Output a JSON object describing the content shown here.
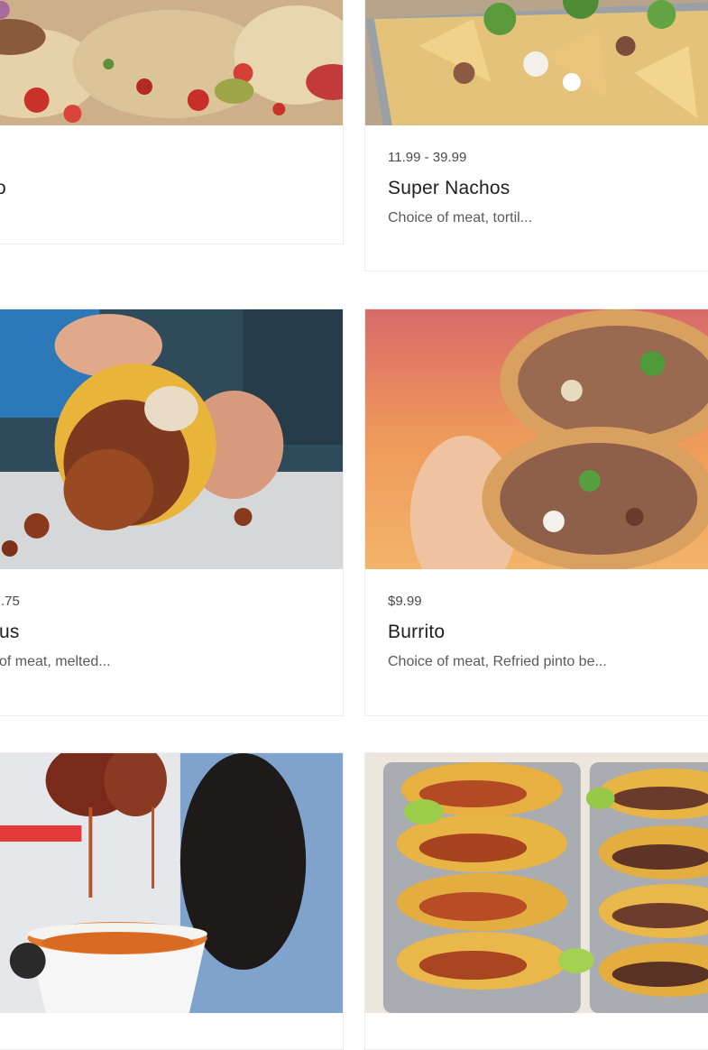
{
  "menu": {
    "items": [
      {
        "price": "",
        "name": "piro",
        "description": "",
        "photo_icon": "tacos-platter-photo"
      },
      {
        "price": "11.99 - 39.99",
        "name": "Super Nachos",
        "description": "Choice of meat, tortil...",
        "photo_icon": "nachos-tray-photo"
      },
      {
        "price": ".75",
        "name": "us",
        "description": " of meat, melted...",
        "photo_icon": "quesataco-photo"
      },
      {
        "price": "$9.99",
        "name": "Burrito",
        "description": " Choice of meat, Refried pinto be...",
        "photo_icon": "burrito-photo"
      },
      {
        "price": "",
        "name": "",
        "description": "",
        "photo_icon": "birria-dip-photo"
      },
      {
        "price": "",
        "name": "",
        "description": "",
        "photo_icon": "taco-trays-photo"
      }
    ]
  },
  "colors": {
    "card_border": "#ececec",
    "price_text": "#4a4a4a",
    "name_text": "#1f1f1f",
    "description_text": "#5a5a5a"
  }
}
